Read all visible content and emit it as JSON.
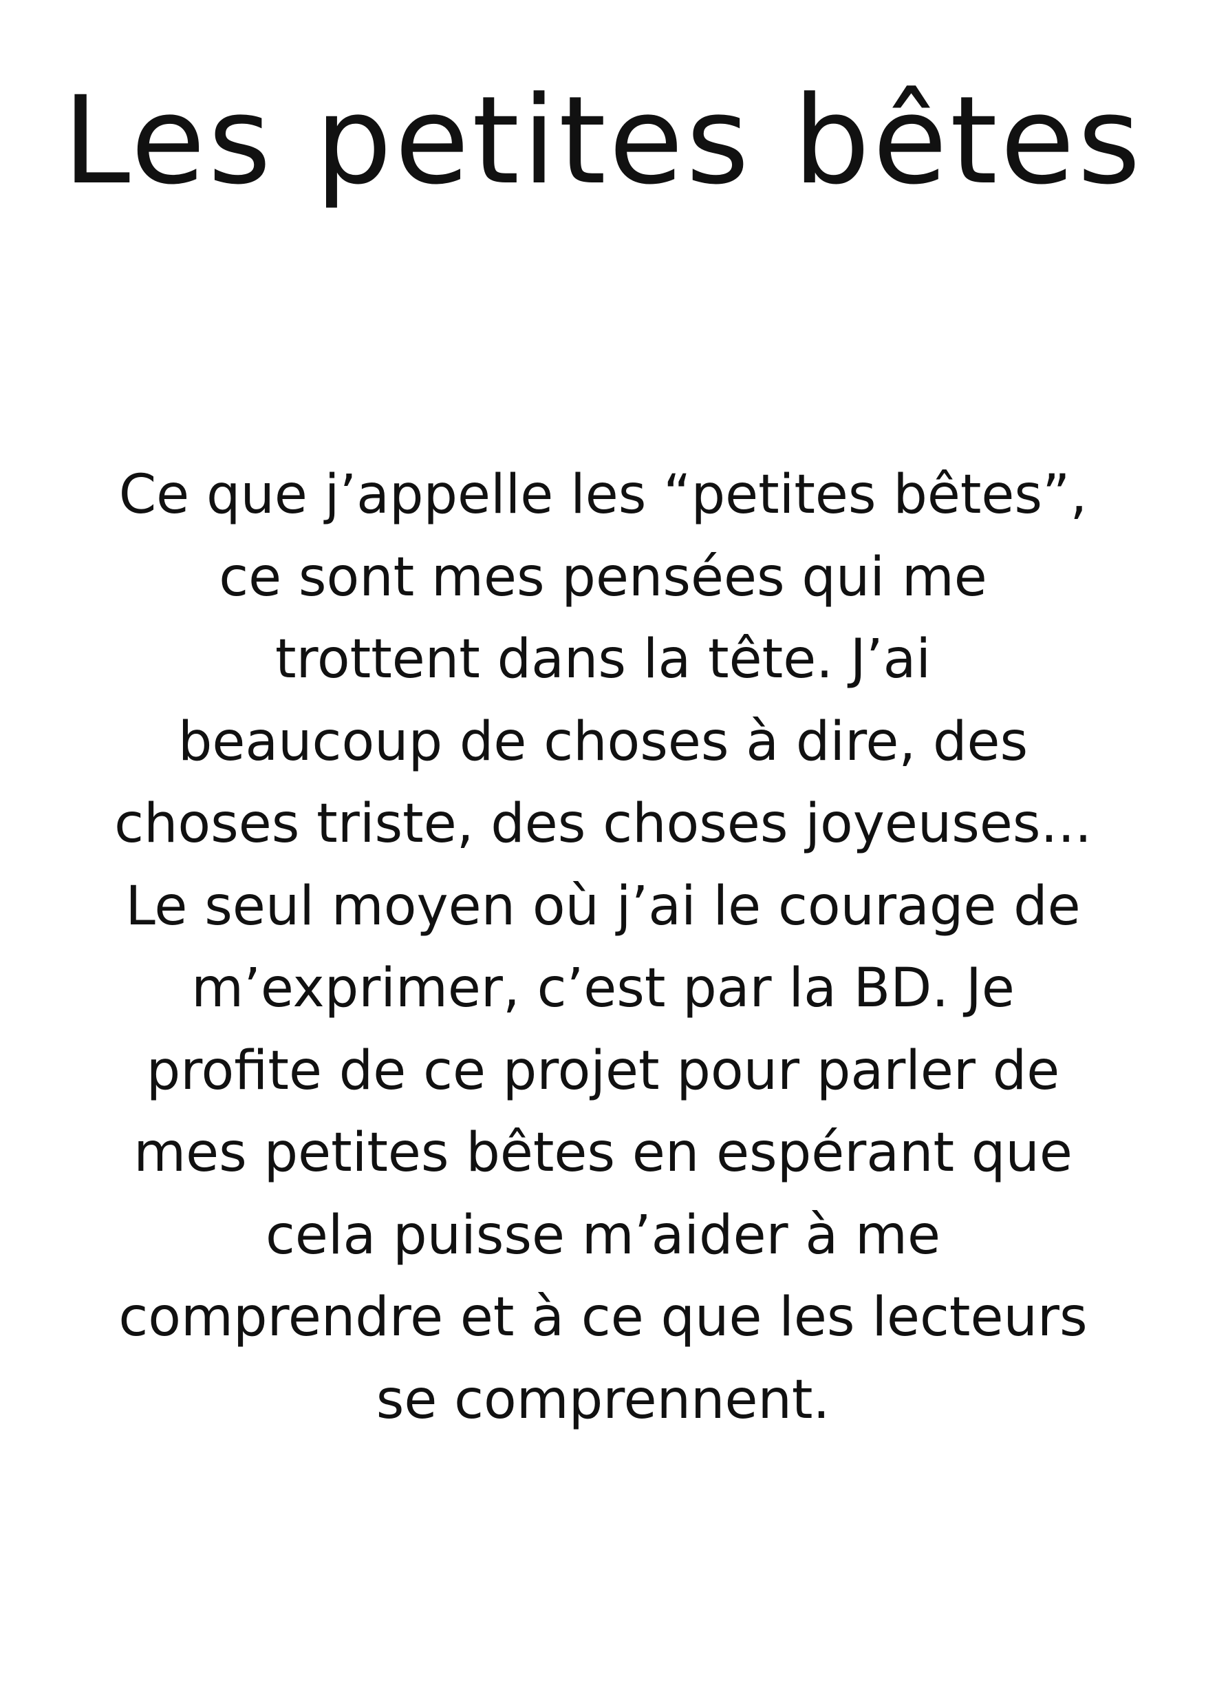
{
  "document": {
    "title": "Les petites bêtes",
    "paragraph_lines": [
      "Ce que j’appelle les “petites bêtes”,",
      "ce sont mes pensées qui me",
      "trottent dans la tête. J’ai",
      "beaucoup de choses à dire, des",
      "choses triste, des choses joyeuses...",
      "Le seul moyen où j’ai le courage de",
      "m’exprimer, c’est par la BD. Je",
      "profite de ce projet pour parler de",
      "mes petites bêtes en espérant que",
      "cela puisse m’aider à me",
      "comprendre et à ce que les lecteurs",
      "se comprennent."
    ]
  },
  "colors": {
    "background": "#ffffff",
    "text": "#111111"
  }
}
